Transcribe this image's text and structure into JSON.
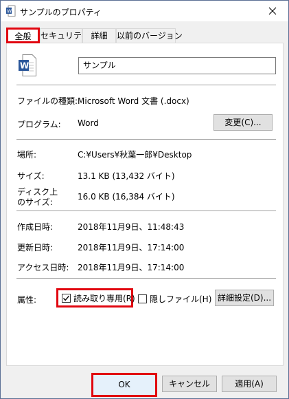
{
  "window": {
    "title": "サンプルのプロパティ"
  },
  "tabs": [
    {
      "label": "全般"
    },
    {
      "label": "セキュリティ"
    },
    {
      "label": "詳細"
    },
    {
      "label": "以前のバージョン"
    }
  ],
  "general": {
    "file_name": "サンプル",
    "file_type_label": "ファイルの種類:",
    "file_type_value": "Microsoft Word 文書 (.docx)",
    "program_label": "プログラム:",
    "program_value": "Word",
    "change_button": "変更(C)...",
    "location_label": "場所:",
    "location_value": "C:¥Users¥秋葉一郎¥Desktop",
    "size_label": "サイズ:",
    "size_value": "13.1 KB (13,432 バイト)",
    "disk_size_label_1": "ディスク上",
    "disk_size_label_2": "のサイズ:",
    "disk_size_value": "16.0 KB (16,384 バイト)",
    "created_label": "作成日時:",
    "created_value": "2018年11月9日、11:48:43",
    "modified_label": "更新日時:",
    "modified_value": "2018年11月9日、17:14:00",
    "accessed_label": "アクセス日時:",
    "accessed_value": "2018年11月9日、17:14:00",
    "attributes_label": "属性:",
    "readonly_label": "読み取り専用(R)",
    "readonly_checked": true,
    "hidden_label": "隠しファイル(H)",
    "hidden_checked": false,
    "advanced_button": "詳細設定(D)..."
  },
  "footer": {
    "ok": "OK",
    "cancel": "キャンセル",
    "apply": "適用(A)"
  },
  "colors": {
    "highlight": "#e1060f",
    "word_blue": "#2b579a"
  }
}
